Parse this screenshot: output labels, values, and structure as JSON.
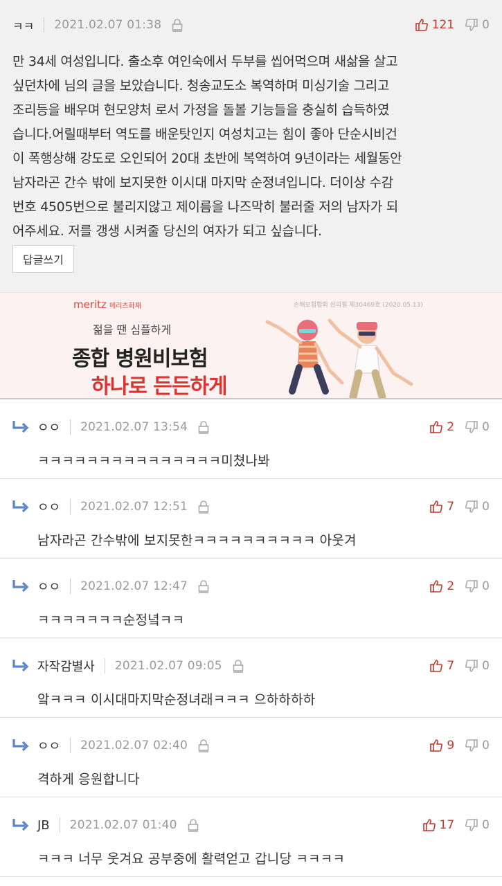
{
  "main_post": {
    "author": "ㅋㅋ",
    "date": "2021.02.07 01:38",
    "upvotes": "121",
    "downvotes": "0",
    "body_lines": [
      "만 34세 여성입니다. 출소후 여인숙에서 두부를 씹어먹으며 새삶을 살고",
      "싶던차에 님의 글을 보았습니다. 청송교도소 복역하며 미싱기술 그리고",
      "조리등을 배우며 현모양처 로서 가정을 돌볼 기능들을 충실히 습득하였",
      "습니다.어릴때부터 역도를 배운탓인지 여성치고는 힘이 좋아 단순시비건",
      "이 폭행상해 강도로 오인되어 20대 초반에 복역하여 9년이라는 세월동안",
      "남자라곤 간수 밖에 보지못한 이시대 마지막 순정녀입니다. 더이상 수감",
      "번호 4505번으로 불리지않고 제이름을 나즈막히 불러줄 저의 남자가 되",
      "어주세요. 저를 갱생 시켜줄 당신의 여자가 되고 싶습니다."
    ],
    "reply_button": "답글쓰기"
  },
  "ad": {
    "brand": "meritz",
    "brand_sub": "메리츠화재",
    "legal": "손해보험협회 심의필 제30469호 (2020.05.13)",
    "subtitle": "젊을 땐 심플하게",
    "title_line1": "종합 병원비보험",
    "title_line2": "하나로 든든하게"
  },
  "comments": [
    {
      "author": "ㅇㅇ",
      "date": "2021.02.07 13:54",
      "up": "2",
      "down": "0",
      "text": "ㅋㅋㅋㅋㅋㅋㅋㅋㅋㅋㅋㅋㅋㅋㅋ미쳤나봐"
    },
    {
      "author": "ㅇㅇ",
      "date": "2021.02.07 12:51",
      "up": "7",
      "down": "0",
      "text": "남자라곤 간수밖에 보지못한ㅋㅋㅋㅋㅋㅋㅋㅋㅋㅋ 아웃겨"
    },
    {
      "author": "ㅇㅇ",
      "date": "2021.02.07 12:47",
      "up": "2",
      "down": "0",
      "text": "ㅋㅋㅋㅋㅋㅋㅋ순정녘ㅋㅋ"
    },
    {
      "author": "자작감별사",
      "date": "2021.02.07 09:05",
      "up": "7",
      "down": "0",
      "text": "앜ㅋㅋㅋ 이시대마지막순정녀래ㅋㅋㅋ 으하하하하"
    },
    {
      "author": "ㅇㅇ",
      "date": "2021.02.07 02:40",
      "up": "9",
      "down": "0",
      "text": "격하게 응원합니다"
    },
    {
      "author": "JB",
      "date": "2021.02.07 01:40",
      "up": "17",
      "down": "0",
      "text": "ㅋㅋㅋ 너무 웃겨요 공부중에 활력얻고 갑니당 ㅋㅋㅋㅋ"
    }
  ],
  "colors": {
    "upvote": "#c0392b",
    "muted": "#9a9a9a",
    "ad_red": "#e0322c"
  },
  "icons": [
    "lock-icon",
    "thumbs-up-icon",
    "thumbs-down-icon",
    "reply-arrow-icon"
  ]
}
